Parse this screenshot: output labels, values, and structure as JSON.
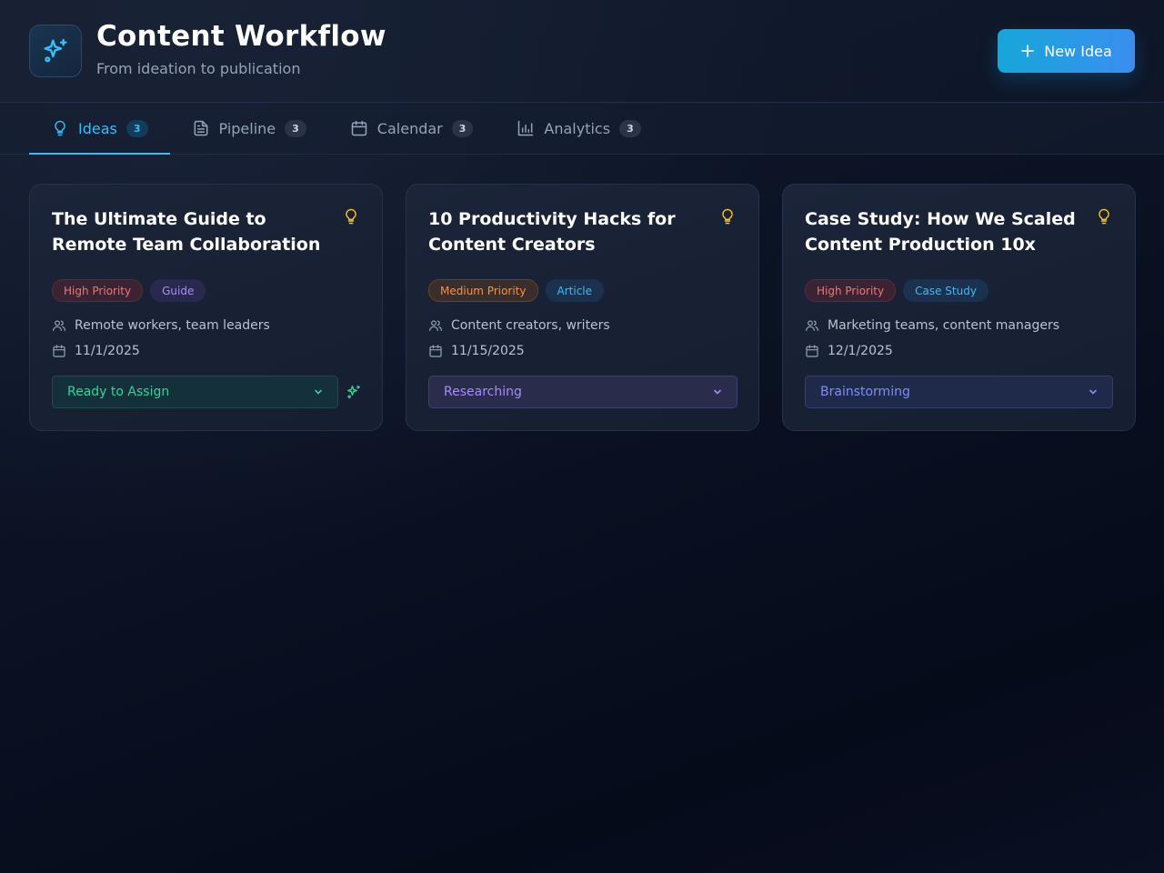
{
  "header": {
    "title": "Content Workflow",
    "subtitle": "From ideation to publication",
    "logo_icon": "sparkles-icon",
    "new_button_label": "New Idea"
  },
  "tabs": [
    {
      "label": "Ideas",
      "count": "3",
      "icon": "lightbulb-icon",
      "active": true
    },
    {
      "label": "Pipeline",
      "count": "3",
      "icon": "document-icon",
      "active": false
    },
    {
      "label": "Calendar",
      "count": "3",
      "icon": "calendar-icon",
      "active": false
    },
    {
      "label": "Analytics",
      "count": "3",
      "icon": "bar-chart-icon",
      "active": false
    }
  ],
  "cards": [
    {
      "title": "The Ultimate Guide to Remote Team Collaboration",
      "priority": "High Priority",
      "type": "Guide",
      "audience": "Remote workers, team leaders",
      "date": "11/1/2025",
      "status": "Ready to Assign"
    },
    {
      "title": "10 Productivity Hacks for Content Creators",
      "priority": "Medium Priority",
      "type": "Article",
      "audience": "Content creators, writers",
      "date": "11/15/2025",
      "status": "Researching"
    },
    {
      "title": "Case Study: How We Scaled Content Production 10x",
      "priority": "High Priority",
      "type": "Case Study",
      "audience": "Marketing teams, content managers",
      "date": "12/1/2025",
      "status": "Brainstorming"
    }
  ],
  "colors": {
    "accent": "#38bdf8",
    "button_gradient_start": "#17a6d9",
    "button_gradient_end": "#3b8ef0",
    "high_priority": "#f87171",
    "medium_priority": "#fb923c",
    "bulb": "#fbbf24",
    "status_ready": "#34d399",
    "status_researching": "#a78bfa",
    "status_brainstorming": "#818cf8"
  }
}
